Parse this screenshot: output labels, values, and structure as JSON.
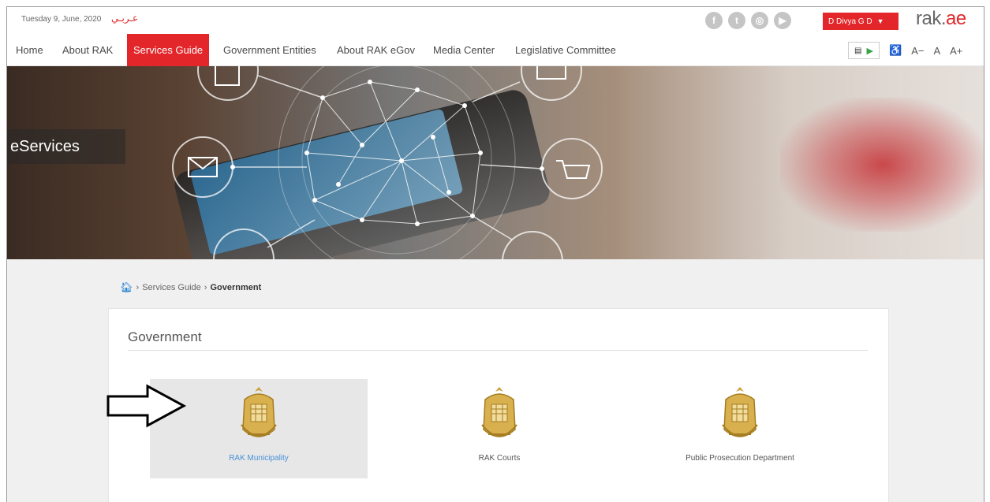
{
  "topbar": {
    "date": "Tuesday 9, June, 2020",
    "language": "عـربـي",
    "socials": [
      {
        "icon": "facebook-icon",
        "glyph": "f"
      },
      {
        "icon": "twitter-icon",
        "glyph": "t"
      },
      {
        "icon": "instagram-icon",
        "glyph": "◎"
      },
      {
        "icon": "youtube-icon",
        "glyph": "▶"
      }
    ],
    "user": "D Divya G D",
    "logo_main": "rak.",
    "logo_accent": "ae"
  },
  "nav": {
    "items": [
      "Home",
      "About RAK",
      "Services Guide",
      "Government Entities",
      "About RAK eGov",
      "Media Center",
      "Legislative Committee"
    ],
    "active": "Services Guide",
    "font_tools": [
      "A−",
      "A",
      "A+"
    ]
  },
  "hero": {
    "title": "eServices"
  },
  "breadcrumb": {
    "path": "Services Guide",
    "current": "Government"
  },
  "section": {
    "title": "Government",
    "entities": [
      {
        "name": "RAK Municipality",
        "selected": true
      },
      {
        "name": "RAK Courts",
        "selected": false
      },
      {
        "name": "Public Prosecution Department",
        "selected": false
      }
    ]
  },
  "colors": {
    "accent": "#e2262a",
    "link": "#4a90d9",
    "emblem": "#c9a03c"
  }
}
